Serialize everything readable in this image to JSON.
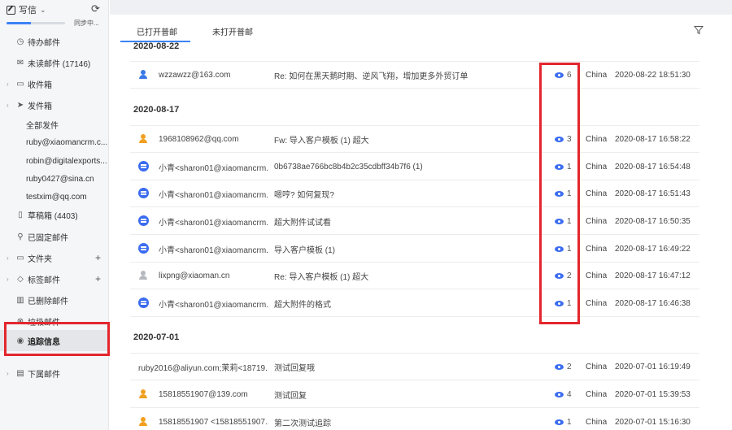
{
  "sidebar": {
    "compose_label": "写信",
    "sync_text": "同步中...",
    "sync_progress": 0.42,
    "items": [
      {
        "label": "待办邮件",
        "icon": "clock-icon",
        "type": "main"
      },
      {
        "label": "未读邮件 (17146)",
        "icon": "envelope-icon",
        "type": "main"
      },
      {
        "label": "收件箱",
        "icon": "inbox-icon",
        "type": "main",
        "expand": true
      },
      {
        "label": "发件箱",
        "icon": "send-icon",
        "type": "main",
        "expand": true
      },
      {
        "label": "全部发件",
        "type": "sub"
      },
      {
        "label": "ruby@xiaomancrm.c...",
        "type": "sub"
      },
      {
        "label": "robin@digitalexports...",
        "type": "sub"
      },
      {
        "label": "ruby0427@sina.cn",
        "type": "sub"
      },
      {
        "label": "testxim@qq.com",
        "type": "sub"
      },
      {
        "label": "草稿箱 (4403)",
        "icon": "draft-icon",
        "type": "main"
      },
      {
        "label": "已固定邮件",
        "icon": "pin-icon",
        "type": "main"
      },
      {
        "label": "文件夹",
        "icon": "folder-icon",
        "type": "main",
        "expand": true,
        "plus": "+"
      },
      {
        "label": "标签邮件",
        "icon": "tag-icon",
        "type": "main",
        "expand": true,
        "plus": "+"
      },
      {
        "label": "已删除邮件",
        "icon": "trash-icon",
        "type": "main"
      },
      {
        "label": "垃圾邮件",
        "icon": "spam-icon",
        "type": "main"
      },
      {
        "label": "追踪信息",
        "icon": "eye-icon",
        "type": "main",
        "active": true
      },
      {
        "label": "下属邮件",
        "icon": "subordinate-icon",
        "type": "main",
        "expand": true
      }
    ]
  },
  "tabs": [
    {
      "label": "已打开普邮"
    },
    {
      "label": "未打开普邮"
    }
  ],
  "groups": [
    {
      "date": "2020-08-22",
      "rows": [
        {
          "avatar": "person-blue",
          "sender": "wzzawzz@163.com",
          "subject": "Re: 如何在黑天鹅时期、逆风飞翔，增加更多外贸订单",
          "views": "6",
          "country": "China",
          "time": "2020-08-22 18:51:30"
        }
      ]
    },
    {
      "date": "2020-08-17",
      "rows": [
        {
          "avatar": "person-orange",
          "sender": "1968108962@qq.com",
          "subject": "Fw: 导入客户模板 (1) 超大",
          "views": "3",
          "country": "China",
          "time": "2020-08-17 16:58:22"
        },
        {
          "avatar": "chat",
          "sender": "小青<sharon01@xiaomancrm...",
          "subject": "0b6738ae766bc8b4b2c35cdbff34b7f6 (1)",
          "views": "1",
          "country": "China",
          "time": "2020-08-17 16:54:48"
        },
        {
          "avatar": "chat",
          "sender": "小青<sharon01@xiaomancrm...",
          "subject": "嗯哼? 如何复现?",
          "views": "1",
          "country": "China",
          "time": "2020-08-17 16:51:43"
        },
        {
          "avatar": "chat",
          "sender": "小青<sharon01@xiaomancrm...",
          "subject": "超大附件试试看",
          "views": "1",
          "country": "China",
          "time": "2020-08-17 16:50:35"
        },
        {
          "avatar": "chat",
          "sender": "小青<sharon01@xiaomancrm...",
          "subject": "导入客户模板 (1)",
          "views": "1",
          "country": "China",
          "time": "2020-08-17 16:49:22"
        },
        {
          "avatar": "person-gray",
          "sender": "lixpng@xiaoman.cn",
          "subject": "Re: 导入客户模板 (1) 超大",
          "views": "2",
          "country": "China",
          "time": "2020-08-17 16:47:12"
        },
        {
          "avatar": "chat",
          "sender": "小青<sharon01@xiaomancrm...",
          "subject": "超大附件的格式",
          "views": "1",
          "country": "China",
          "time": "2020-08-17 16:46:38"
        }
      ]
    },
    {
      "date": "2020-07-01",
      "rows": [
        {
          "avatar": "none",
          "sender": "ruby2016@aliyun.com;茉莉<18719...",
          "subject": "测试回复哦",
          "views": "2",
          "country": "China",
          "time": "2020-07-01 16:19:49"
        },
        {
          "avatar": "person-orange",
          "sender": "15818551907@139.com",
          "subject": "测试回复",
          "views": "4",
          "country": "China",
          "time": "2020-07-01 15:39:53"
        },
        {
          "avatar": "person-orange",
          "sender": "15818551907 <15818551907...",
          "subject": "第二次测试追踪",
          "views": "1",
          "country": "China",
          "time": "2020-07-01 15:16:30"
        }
      ]
    }
  ],
  "colors": {
    "accent": "#3b82f6",
    "highlight": "#e3262d",
    "eye": "#3b6cf0"
  }
}
